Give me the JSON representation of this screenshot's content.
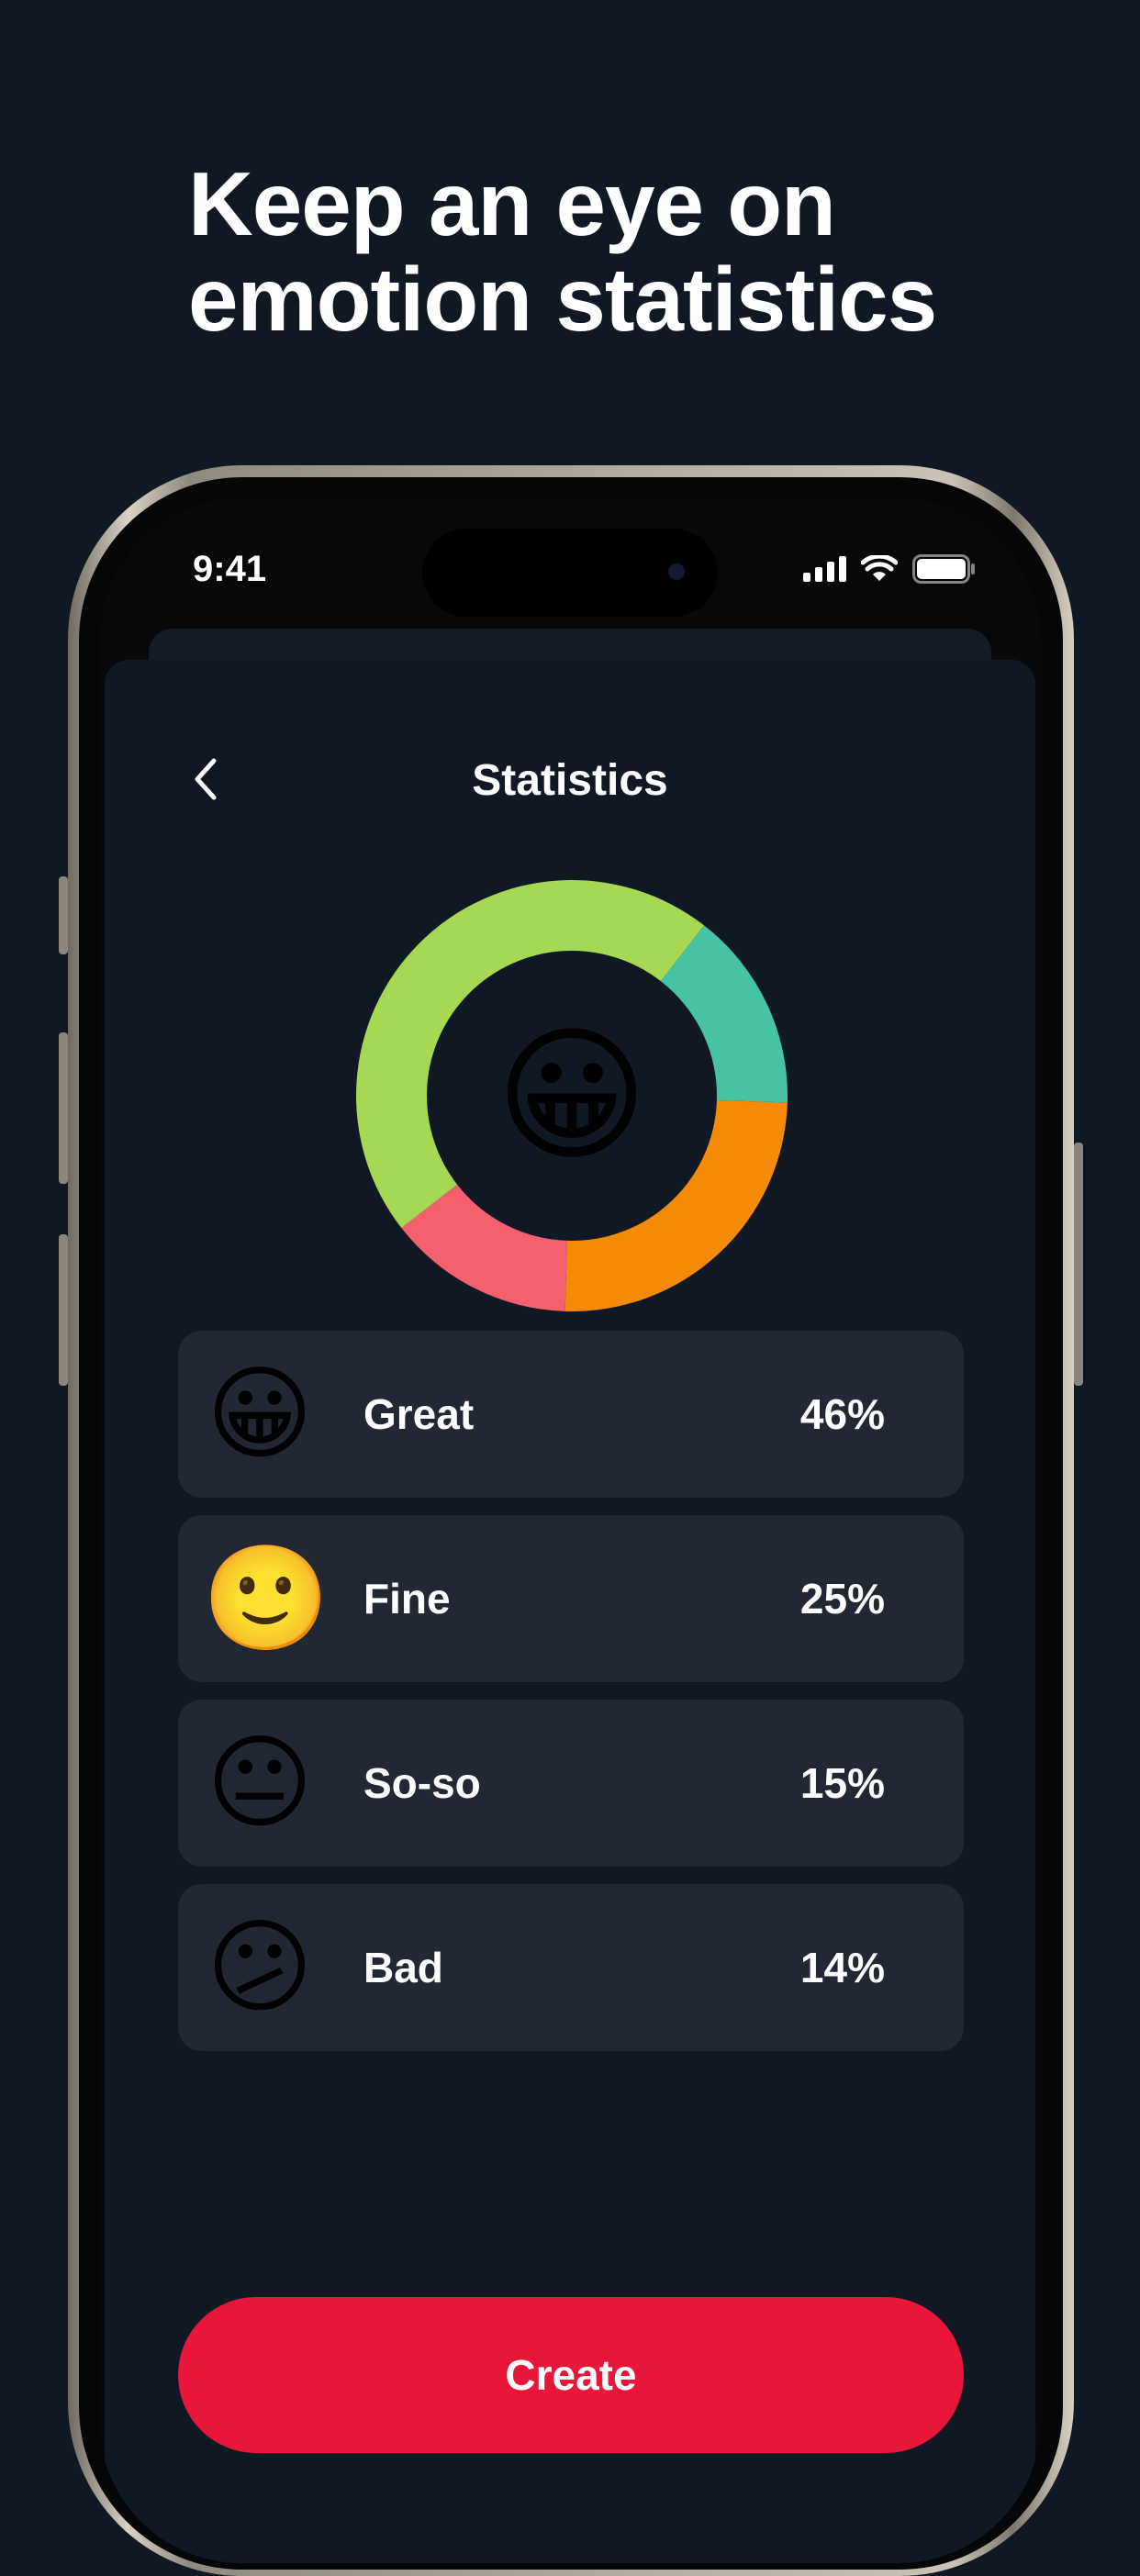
{
  "headline": {
    "line1": "Keep an eye on",
    "line2": "emotion statistics"
  },
  "status_bar": {
    "time": "9:41",
    "icons": [
      "cellular-signal-icon",
      "wifi-icon",
      "battery-icon"
    ]
  },
  "nav": {
    "back_icon": "chevron-left-icon",
    "title": "Statistics"
  },
  "donut": {
    "center_emoji": "😀"
  },
  "emotions": [
    {
      "emoji": "😀",
      "label": "Great",
      "percent": "46%",
      "value": 46,
      "color": "#a6d854"
    },
    {
      "emoji": "🙂",
      "label": "Fine",
      "percent": "25%",
      "value": 25,
      "color": "#f58a07"
    },
    {
      "emoji": "😐",
      "label": "So-so",
      "percent": "15%",
      "value": 15,
      "color": "#46c3a2"
    },
    {
      "emoji": "😕",
      "label": "Bad",
      "percent": "14%",
      "value": 14,
      "color": "#f4606d"
    }
  ],
  "chart_data": {
    "type": "pie",
    "categories": [
      "Great",
      "Fine",
      "So-so",
      "Bad"
    ],
    "values": [
      46,
      25,
      15,
      14
    ],
    "colors": [
      "#a6d854",
      "#f58a07",
      "#46c3a2",
      "#f4606d"
    ]
  },
  "actions": {
    "create_label": "Create"
  },
  "colors": {
    "background": "#101824",
    "card": "#212834",
    "accent": "#e8173a"
  }
}
